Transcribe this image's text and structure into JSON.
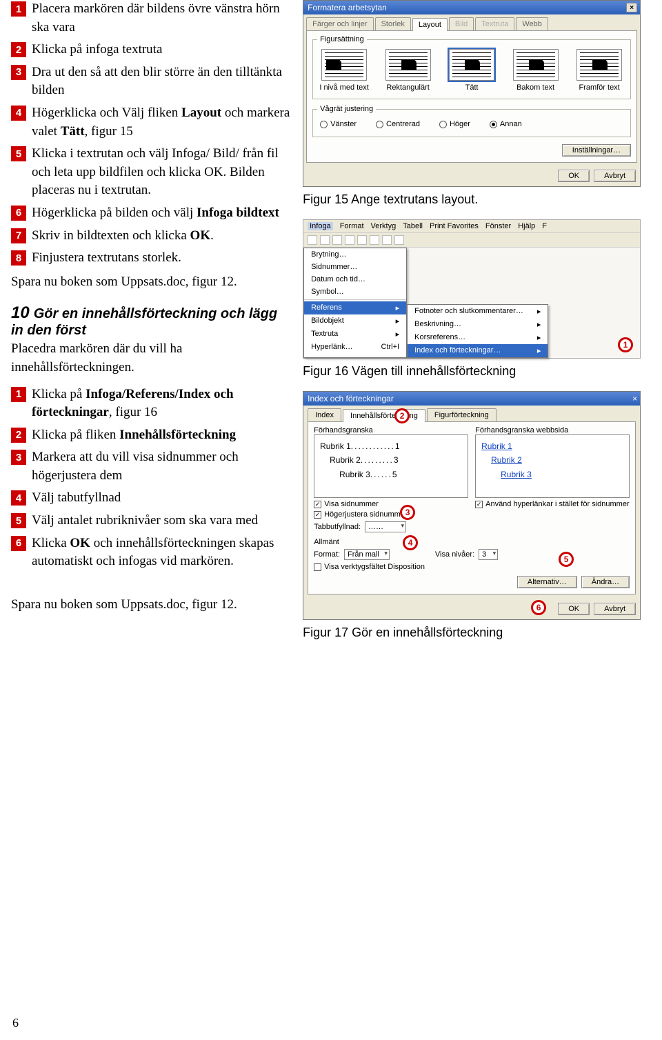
{
  "left": {
    "listA": [
      {
        "n": "1",
        "html": "Placera markören där bildens övre vänstra hörn ska vara"
      },
      {
        "n": "2",
        "html": "Klicka på infoga textruta"
      },
      {
        "n": "3",
        "html": "Dra ut den så att den blir större än den tilltänkta bilden"
      },
      {
        "n": "4",
        "html": "Högerklicka och Välj fliken <b>Layout</b> och markera valet <b>Tätt</b>, figur 15"
      },
      {
        "n": "5",
        "html": "Klicka i textrutan och välj Infoga/ Bild/ från fil och leta upp bildfilen och klicka OK. Bilden placeras nu i textrutan."
      },
      {
        "n": "6",
        "html": "Högerklicka på bilden och välj <b>Infoga bildtext</b>"
      },
      {
        "n": "7",
        "html": "Skriv in bildtexten och klicka <b>OK</b>."
      },
      {
        "n": "8",
        "html": "Finjustera textrutans storlek."
      }
    ],
    "paraA": "Spara nu boken som Uppsats.doc, figur 12.",
    "section10_num": "10",
    "section10_title": "Gör en innehållsförteckning och lägg in den först",
    "section10_intro": "Placedra markören där du vill ha innehållsförteckningen.",
    "listB": [
      {
        "n": "1",
        "html": "Klicka på <b>Infoga/Referens/Index och förteckningar</b>, figur 16"
      },
      {
        "n": "2",
        "html": "Klicka på fliken <b>Innehållsförteckning</b>"
      },
      {
        "n": "3",
        "html": "Markera att du vill visa sidnummer och högerjustera dem"
      },
      {
        "n": "4",
        "html": "Välj tabutfyllnad"
      },
      {
        "n": "5",
        "html": "Välj antalet rubriknivåer som ska vara med"
      },
      {
        "n": "6",
        "html": "Klicka <b>OK</b> och innehållsförteckningen skapas automatiskt och infogas vid markören."
      }
    ],
    "paraB": "Spara nu boken som Uppsats.doc, figur 12."
  },
  "captions": {
    "fig15": "Figur 15 Ange textrutans layout.",
    "fig16": "Figur 16  Vägen till innehållsförteckning",
    "fig17": "Figur 17 Gör en innehållsförteckning"
  },
  "dlg1": {
    "title": "Formatera arbetsytan",
    "tabs": [
      "Färger och linjer",
      "Storlek",
      "Layout",
      "Bild",
      "Textruta",
      "Webb"
    ],
    "activeTab": 2,
    "group1": "Figursättning",
    "wrap": [
      "I nivå med text",
      "Rektangulärt",
      "Tätt",
      "Bakom text",
      "Framför text"
    ],
    "group2": "Vågrät justering",
    "radios": [
      "Vänster",
      "Centrerad",
      "Höger",
      "Annan"
    ],
    "radiosSel": 3,
    "btnSettings": "Inställningar…",
    "ok": "OK",
    "cancel": "Avbryt"
  },
  "menu": {
    "menubar": [
      "Infoga",
      "Format",
      "Verktyg",
      "Tabell",
      "Print Favorites",
      "Fönster",
      "Hjälp",
      "F"
    ],
    "drop1": [
      "Brytning…",
      "Sidnummer…",
      "Datum och tid…",
      "Symbol…",
      "Referens",
      "Bildobjekt",
      "Textruta",
      "Hyperlänk…  Ctrl+I"
    ],
    "hover1": 4,
    "drop2": [
      "Fotnoter och slutkommentarer…",
      "Beskrivning…",
      "Korsreferens…",
      "Index och förteckningar…"
    ],
    "hover2": 3,
    "badge": "1"
  },
  "dlg2": {
    "title": "Index och förteckningar",
    "tabs": [
      "Index",
      "Innehållsförteckning",
      "Figurförteckning"
    ],
    "activeTab": 1,
    "prevLabel": "Förhandsgranska",
    "prevWebLabel": "Förhandsgranska webbsida",
    "preview": [
      {
        "t": "Rubrik 1",
        "p": "1"
      },
      {
        "t": "Rubrik 2",
        "p": "3"
      },
      {
        "t": "Rubrik 3",
        "p": "5"
      }
    ],
    "previewWeb": [
      "Rubrik 1",
      "Rubrik 2",
      "Rubrik 3"
    ],
    "chk1": "Visa sidnummer",
    "chk2": "Högerjustera sidnummer",
    "chk3": "Använd hyperlänkar i stället för sidnummer",
    "tabfillLabel": "Tabbutfyllnad:",
    "tabfillVal": "……",
    "allmant": "Allmänt",
    "formatLabel": "Format:",
    "formatVal": "Från mall",
    "levelsLabel": "Visa nivåer:",
    "levelsVal": "3",
    "outlineLabel": "Visa verktygsfältet Disposition",
    "alt": "Alternativ…",
    "mod": "Ändra…",
    "ok": "OK",
    "cancel": "Avbryt",
    "badges": {
      "b2": "2",
      "b3": "3",
      "b4": "4",
      "b5": "5",
      "b6": "6"
    }
  },
  "pageNumber": "6"
}
